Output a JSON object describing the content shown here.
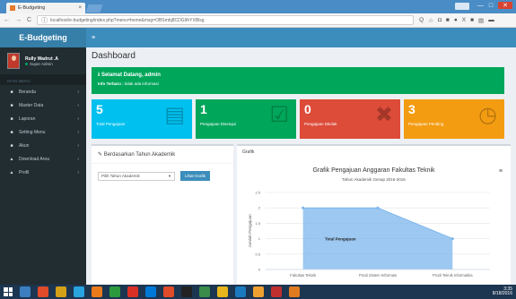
{
  "browser": {
    "tab_title": "E-Budgeting",
    "tab_close": "×",
    "url": "localhost/e-budgeting/index.php?menu=home&msg=OBSmbj8CDG9hYXBlsg",
    "nav_icons": [
      "←",
      "→",
      "C",
      "ⓘ"
    ],
    "ext_icons": [
      "Q",
      "☆",
      "◘",
      "■",
      "●",
      "X",
      "■",
      "▤",
      "▬"
    ],
    "window_controls": [
      "—",
      "□",
      "✕"
    ]
  },
  "sidebar": {
    "logo": "E-Budgeting",
    "user_name": "Rully Wadrut .A",
    "user_role": "Super Admin",
    "nav_header": "MAIN MENU",
    "items": [
      {
        "icon": "■",
        "label": "Beranda"
      },
      {
        "icon": "■",
        "label": "Master Data"
      },
      {
        "icon": "■",
        "label": "Laporan"
      },
      {
        "icon": "■",
        "label": "Setting Menu"
      },
      {
        "icon": "■",
        "label": "Akun"
      },
      {
        "icon": "▲",
        "label": "Download Area"
      },
      {
        "icon": "▲",
        "label": "Profil"
      }
    ],
    "chevron": "‹"
  },
  "topnav": {
    "menu_icon": "≡"
  },
  "page": {
    "title": "Dashboard"
  },
  "callout": {
    "title": "ℹ  Selamat Datang, admin",
    "bold": "Info Terbaru :",
    "text": " tidak ada informasi"
  },
  "stats": [
    {
      "number": "5",
      "label": "Total Pengajuan",
      "color": "#00c0ef",
      "icon": "▤"
    },
    {
      "number": "1",
      "label": "Pengajuan Disetujui",
      "color": "#00a65a",
      "icon": "☑"
    },
    {
      "number": "0",
      "label": "Pengajuan Ditolak",
      "color": "#dd4b39",
      "icon": "✖"
    },
    {
      "number": "3",
      "label": "Pengajuan Pending",
      "color": "#f39c12",
      "icon": "◷"
    }
  ],
  "filter_box": {
    "header": "Berdasarkan Tahun Akademik",
    "select_placeholder": "Pilih Tahun Akademik",
    "button": "Lihat Grafik"
  },
  "chart_box": {
    "header": "Grafik",
    "menu_icon": "≡"
  },
  "chart_data": {
    "type": "area",
    "title": "Grafik Pengajuan Anggaran Fakultas Teknik",
    "subtitle": "Tahun Akademik Genap 2016-2016",
    "ylabel": "Jumlah Pengajuan",
    "ylim": [
      0,
      2.5
    ],
    "yticks": [
      "2.5",
      "2",
      "1.5",
      "1",
      "0.5",
      "0"
    ],
    "categories": [
      "Fakultas Teknik",
      "Prodi Sistem Informasi",
      "Prodi Teknik Informatika"
    ],
    "series": [
      {
        "name": "Total Pengajuan",
        "values": [
          2,
          2,
          1
        ]
      }
    ],
    "color": "#7cb5ec"
  },
  "taskbar": {
    "apps": [
      "#3c7fc1",
      "#e04b2a",
      "#d4a017",
      "#29a3e0",
      "#e87a1c",
      "#2b9a3d",
      "#d93025",
      "#0078d7",
      "#e04b2a",
      "#222222",
      "#3a8c4a",
      "#e8b61c",
      "#1b7abf",
      "#f0a030",
      "#c02f2f",
      "#e07b20"
    ],
    "time": "3:35",
    "date": "8/18/2016"
  }
}
